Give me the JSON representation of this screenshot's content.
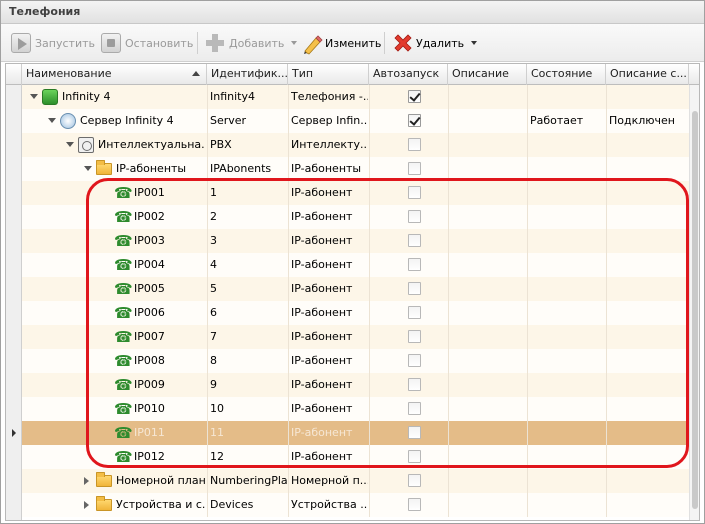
{
  "title": "Телефония",
  "toolbar": {
    "start": "Запустить",
    "stop": "Остановить",
    "add": "Добавить",
    "edit": "Изменить",
    "delete": "Удалить"
  },
  "columns": [
    "Наименование",
    "Идентифик...",
    "Тип",
    "Автозапуск",
    "Описание",
    "Состояние",
    "Описание с..."
  ],
  "rows": [
    {
      "name": "Infinity 4",
      "id": "Infinity4",
      "type": "Телефония -...",
      "autostart": true,
      "desc": "",
      "state": "",
      "statedesc": "",
      "level": 0,
      "expander": "down",
      "icon": "infinity-icon"
    },
    {
      "name": "Сервер Infinity 4",
      "id": "Server",
      "type": "Сервер Infin...",
      "autostart": true,
      "desc": "",
      "state": "Работает",
      "statedesc": "Подключен",
      "level": 1,
      "expander": "down",
      "icon": "server-icon"
    },
    {
      "name": "Интеллектуальна...",
      "id": "PBX",
      "type": "Интеллекту...",
      "autostart": false,
      "desc": "",
      "state": "",
      "statedesc": "",
      "level": 2,
      "expander": "down",
      "icon": "pbx-icon"
    },
    {
      "name": "IP-абоненты",
      "id": "IPAbonents",
      "type": "IP-абоненты",
      "autostart": false,
      "desc": "",
      "state": "",
      "statedesc": "",
      "level": 3,
      "expander": "down",
      "icon": "folder-icon"
    },
    {
      "name": "IP001",
      "id": "1",
      "type": "IP-абонент",
      "autostart": false,
      "level": 4,
      "icon": "phone-icon"
    },
    {
      "name": "IP002",
      "id": "2",
      "type": "IP-абонент",
      "autostart": false,
      "level": 4,
      "icon": "phone-icon"
    },
    {
      "name": "IP003",
      "id": "3",
      "type": "IP-абонент",
      "autostart": false,
      "level": 4,
      "icon": "phone-icon"
    },
    {
      "name": "IP004",
      "id": "4",
      "type": "IP-абонент",
      "autostart": false,
      "level": 4,
      "icon": "phone-icon"
    },
    {
      "name": "IP005",
      "id": "5",
      "type": "IP-абонент",
      "autostart": false,
      "level": 4,
      "icon": "phone-icon"
    },
    {
      "name": "IP006",
      "id": "6",
      "type": "IP-абонент",
      "autostart": false,
      "level": 4,
      "icon": "phone-icon"
    },
    {
      "name": "IP007",
      "id": "7",
      "type": "IP-абонент",
      "autostart": false,
      "level": 4,
      "icon": "phone-icon"
    },
    {
      "name": "IP008",
      "id": "8",
      "type": "IP-абонент",
      "autostart": false,
      "level": 4,
      "icon": "phone-icon"
    },
    {
      "name": "IP009",
      "id": "9",
      "type": "IP-абонент",
      "autostart": false,
      "level": 4,
      "icon": "phone-icon"
    },
    {
      "name": "IP010",
      "id": "10",
      "type": "IP-абонент",
      "autostart": false,
      "level": 4,
      "icon": "phone-icon"
    },
    {
      "name": "IP011",
      "id": "11",
      "type": "IP-абонент",
      "autostart": false,
      "level": 4,
      "icon": "phone-icon",
      "selected": true
    },
    {
      "name": "IP012",
      "id": "12",
      "type": "IP-абонент",
      "autostart": false,
      "level": 4,
      "icon": "phone-icon"
    },
    {
      "name": "Номерной план",
      "id": "NumberingPlan",
      "type": "Номерной п...",
      "autostart": false,
      "level": 3,
      "expander": "right",
      "icon": "folder-icon"
    },
    {
      "name": "Устройства и с...",
      "id": "Devices",
      "type": "Устройства ...",
      "autostart": false,
      "level": 3,
      "expander": "right",
      "icon": "folder-icon"
    }
  ],
  "colors": {
    "accent": "#e0161c",
    "selection": "#e4bc88",
    "row_odd": "#fdf6e8",
    "phone": "#2e8b2e"
  }
}
